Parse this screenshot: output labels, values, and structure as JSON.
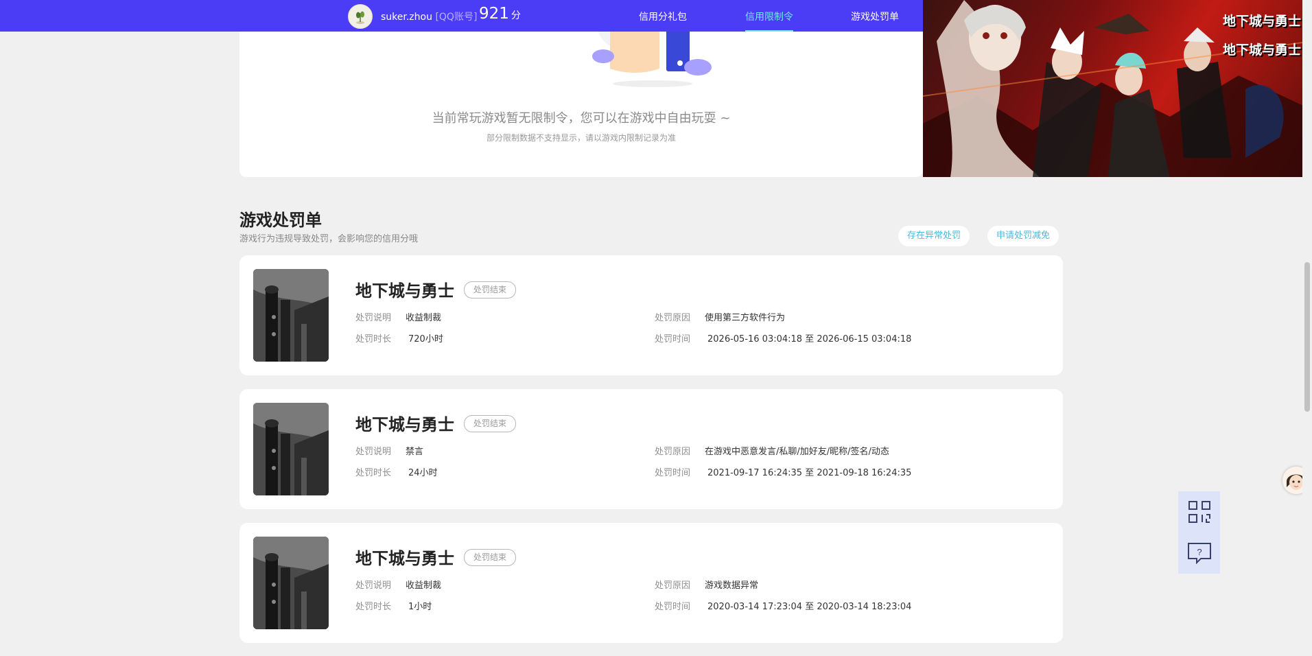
{
  "header": {
    "username": "suker.zhou",
    "account_type": "[QQ账号]",
    "score": "921",
    "score_unit": "分",
    "nav": [
      "信用分礼包",
      "信用限制令",
      "游戏处罚单"
    ],
    "active_nav": "信用限制令"
  },
  "banner": {
    "logo_line1": "地下城与勇士",
    "logo_line2": "地下城与勇士"
  },
  "restriction": {
    "empty_message": "当前常玩游戏暂无限制令，您可以在游戏中自由玩耍 ~",
    "empty_note": "部分限制数据不支持显示，请以游戏内限制记录为准"
  },
  "penalty_section": {
    "title": "游戏处罚单",
    "subtitle": "游戏行为违规导致处罚，会影响您的信用分哦",
    "buttons": [
      "存在异常处罚",
      "申请处罚减免"
    ]
  },
  "field_labels": {
    "desc": "处罚说明",
    "duration": "处罚时长",
    "reason": "处罚原因",
    "time": "处罚时间"
  },
  "penalties": [
    {
      "game": "地下城与勇士",
      "status": "处罚结束",
      "desc": "收益制裁",
      "duration": "720小时",
      "reason": "使用第三方软件行为",
      "time": "2026-05-16 03:04:18 至 2026-06-15 03:04:18"
    },
    {
      "game": "地下城与勇士",
      "status": "处罚结束",
      "desc": "禁言",
      "duration": "24小时",
      "reason": "在游戏中恶意发言/私聊/加好友/昵称/签名/动态",
      "time": "2021-09-17 16:24:35 至 2021-09-18 16:24:35"
    },
    {
      "game": "地下城与勇士",
      "status": "处罚结束",
      "desc": "收益制裁",
      "duration": "1小时",
      "reason": "游戏数据异常",
      "time": "2020-03-14 17:23:04 至 2020-03-14 18:23:04"
    }
  ],
  "icons": {
    "qrcode": "qrcode-icon",
    "help": "help-chat-icon",
    "service": "customer-service-avatar-icon"
  }
}
